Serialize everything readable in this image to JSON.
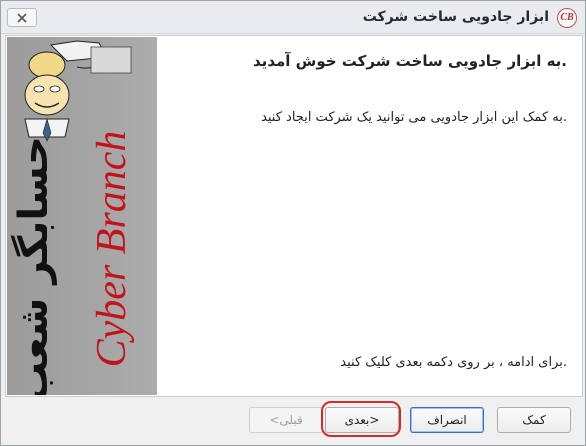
{
  "window": {
    "title": "ابزار جادویی ساخت شرکت",
    "app_icon_text": "CB",
    "app_icon": "cyber-branch-logo-icon",
    "close_icon": "close-icon"
  },
  "banner": {
    "brand_fa": "حسابگر شعب",
    "brand_en": "Cyber Branch",
    "brand_fa_color": "#111111",
    "brand_en_color": "#c4121a",
    "background": "#a3a3a3"
  },
  "main": {
    "welcome_title": ".به ابزار جادویی ساخت شرکت خوش آمدید",
    "description": ".به کمک این ابزار جادویی می توانید یک شرکت ایجاد کنید",
    "instruction": ".برای ادامه ، بر روی دکمه بعدی کلیک کنید"
  },
  "footer": {
    "help_label": "کمک",
    "cancel_label": "انصراف",
    "next_label": "<بعدی",
    "back_label": "قبلی>",
    "back_enabled": false,
    "highlight_color": "#d62b2b"
  }
}
